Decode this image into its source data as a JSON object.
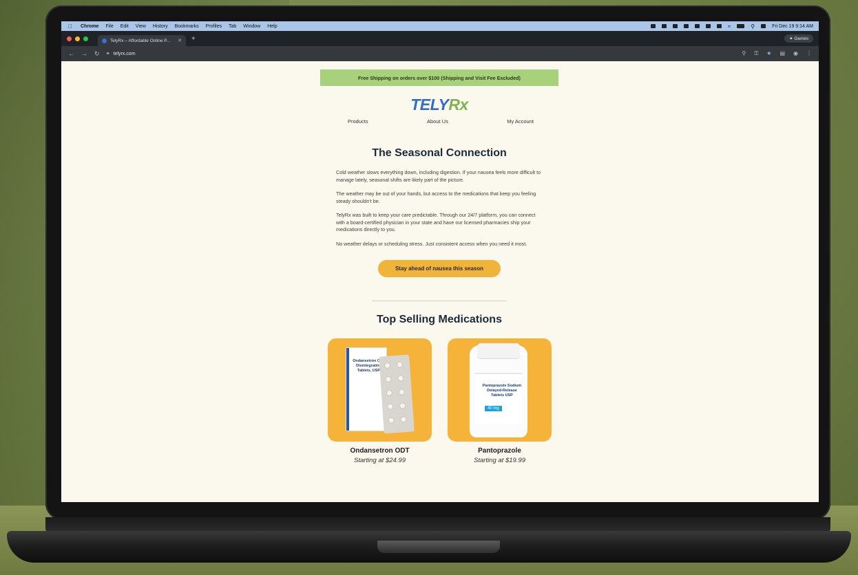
{
  "menubar": {
    "app": "Chrome",
    "items": [
      "File",
      "Edit",
      "View",
      "History",
      "Bookmarks",
      "Profiles",
      "Tab",
      "Window",
      "Help"
    ],
    "datetime": "Fri Dec 19  9:14 AM"
  },
  "tab": {
    "title": "TelyRx – Affordable Online P...",
    "new_tab": "+",
    "gemini": "✦ Gemini"
  },
  "addressbar": {
    "url": "telyrx.com"
  },
  "email": {
    "promo": "Free Shipping on orders over $100 (Shipping and Visit Fee Excluded)",
    "logo_part1": "TELY",
    "logo_part2": "Rx",
    "nav": [
      "Products",
      "About Us",
      "My Account"
    ],
    "heading": "The Seasonal Connection",
    "paragraphs": [
      "Cold weather slows everything down, including digestion. If your nausea feels more difficult to manage lately, seasonal shifts are likely part of the picture.",
      "The weather may be out of your hands, but access to the medications that keep you feeling steady shouldn't be.",
      "TelyRx was built to keep your care predictable. Through our 24/7 platform, you can connect with a board-certified physician in your state and have our licensed pharmacies ship your medications directly to you.",
      "No weather delays or scheduling stress. Just consistent access when you need it most."
    ],
    "cta": "Stay ahead of nausea this season",
    "section_heading": "Top Selling Medications",
    "products": [
      {
        "name": "Ondansetron ODT",
        "price": "Starting at $24.99",
        "box_label": "Ondansetron Oral Disintegrating Tablets, USP"
      },
      {
        "name": "Pantoprazole",
        "price": "Starting at $19.99",
        "bottle_label": "Pantoprazole Sodium Delayed-Release Tablets USP",
        "strength": "40 mg"
      }
    ]
  },
  "colors": {
    "promo_bg": "#a8d17c",
    "logo_blue": "#2f6fc4",
    "logo_green": "#7fb350",
    "cta_bg": "#f0b43a",
    "product_bg": "#f5b33a"
  }
}
